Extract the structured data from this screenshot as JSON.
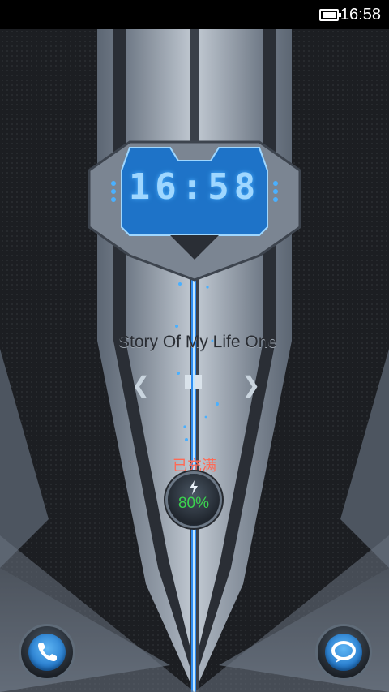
{
  "status_bar": {
    "time": "16:58",
    "battery_icon": "battery-full-icon"
  },
  "lock_clock": {
    "time": "16:58"
  },
  "music": {
    "song_title": "Story Of My Life   One Direction",
    "prev_icon": "chevron-left-icon",
    "pause_icon": "pause-icon",
    "next_icon": "chevron-right-icon"
  },
  "charging": {
    "status": "已充满",
    "percent": "80%",
    "bolt_icon": "lightning-bolt-icon"
  },
  "shortcuts": {
    "phone_icon": "phone-handset-icon",
    "message_icon": "speech-bubble-icon"
  },
  "colors": {
    "accent_blue": "#1e73c8",
    "charge_red": "#ff6a55",
    "charge_green": "#3bd44f"
  }
}
